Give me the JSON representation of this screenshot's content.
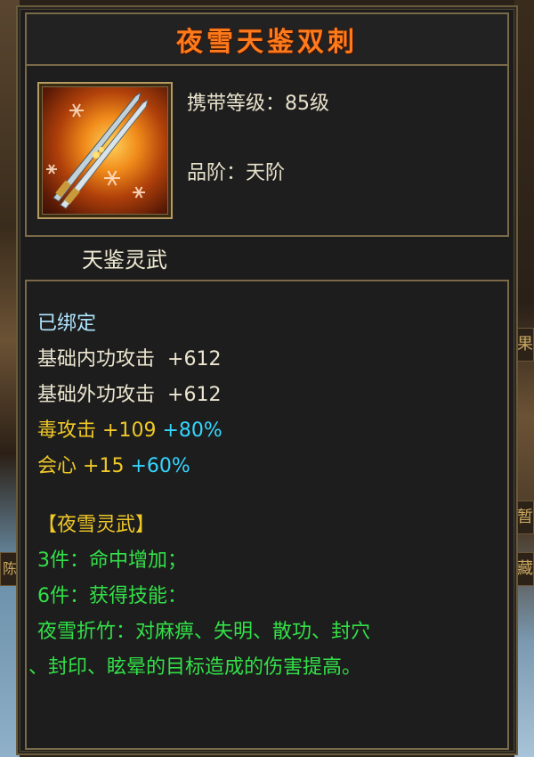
{
  "item": {
    "name": "夜雪天鉴双刺",
    "level_label": "携带等级：85级",
    "grade_label": "品阶：天阶",
    "category": "天鉴灵武",
    "icon": "twin-daggers-icon"
  },
  "attributes": {
    "bound": "已绑定",
    "stats": [
      {
        "label": "基础内功攻击",
        "value": "+612",
        "bonus": ""
      },
      {
        "label": "基础外功攻击",
        "value": "+612",
        "bonus": ""
      },
      {
        "label": "毒攻击",
        "value": "+109",
        "bonus": "+80%"
      },
      {
        "label": "会心",
        "value": "+15",
        "bonus": "+60%"
      }
    ]
  },
  "set": {
    "name": "【夜雪灵武】",
    "bonus3": "3件：命中增加；",
    "bonus6": "6件：获得技能：",
    "skill_line1": "夜雪折竹：对麻痹、失明、散功、封穴",
    "skill_line2": "、封印、眩晕的目标造成的伤害提高。"
  },
  "side_tabs": [
    "果",
    "暂",
    "藏",
    "陈"
  ],
  "colors": {
    "title": "#ff7a1a",
    "bound": "#b0e6ff",
    "stat_white": "#ece6d0",
    "stat_yellow": "#f0c828",
    "bonus_cyan": "#33d6ff",
    "set_green": "#33e048"
  }
}
